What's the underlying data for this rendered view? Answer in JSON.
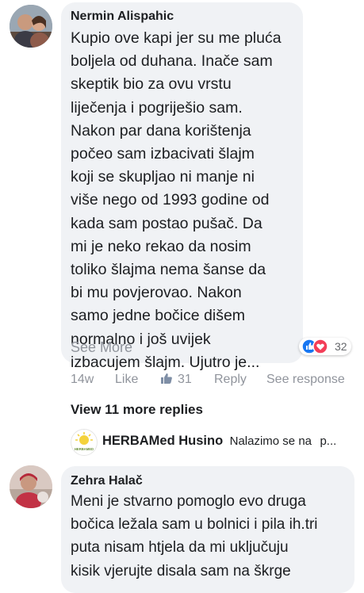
{
  "comments": [
    {
      "author": "Nermin Alispahic",
      "lines": [
        "Kupio ove kapi jer su me pluća",
        "boljela od duhana. Inače sam",
        "skeptik bio za ovu vrstu",
        "liječenja i pogriješio sam.",
        "Nakon par dana korištenja",
        "počeo sam izbacivati šlajm",
        "koji se skupljao ni manje ni",
        "više nego od 1993 godine od",
        "kada sam postao pušač. Da",
        "mi je neko rekao da nosim",
        "toliko šlajma nema šanse da",
        "bi mu povjerovao. Nakon",
        "samo jedne bočice dišem",
        "normalno i još uvijek",
        "izbacujem šlajm. Ujutro je..."
      ],
      "see_more": "See More",
      "reaction_count": "32",
      "time": "14w",
      "like_label": "Like",
      "like_count": "31",
      "reply_label": "Reply",
      "see_response_label": "See response"
    },
    {
      "author": "Zehra Halač",
      "lines": [
        "Meni je stvarno pomoglo evo druga",
        "bočica ležala sam u bolnici i pila ih.tri",
        "puta nisam htjela da mi uključuju",
        "kisik vjerujte disala sam na škrge"
      ]
    }
  ],
  "view_more_replies": "View 11 more replies",
  "reply_preview": {
    "author": "HERBAMed Husino",
    "text": "Nalazimo se na",
    "ellipsis": "p...",
    "logo_text": "HERBAMED"
  },
  "colors": {
    "bubble": "#f0f2f5",
    "meta": "#90949c",
    "like_blue": "#1877f2",
    "love_red": "#f33e58",
    "logo_yellow": "#f4d23c"
  }
}
